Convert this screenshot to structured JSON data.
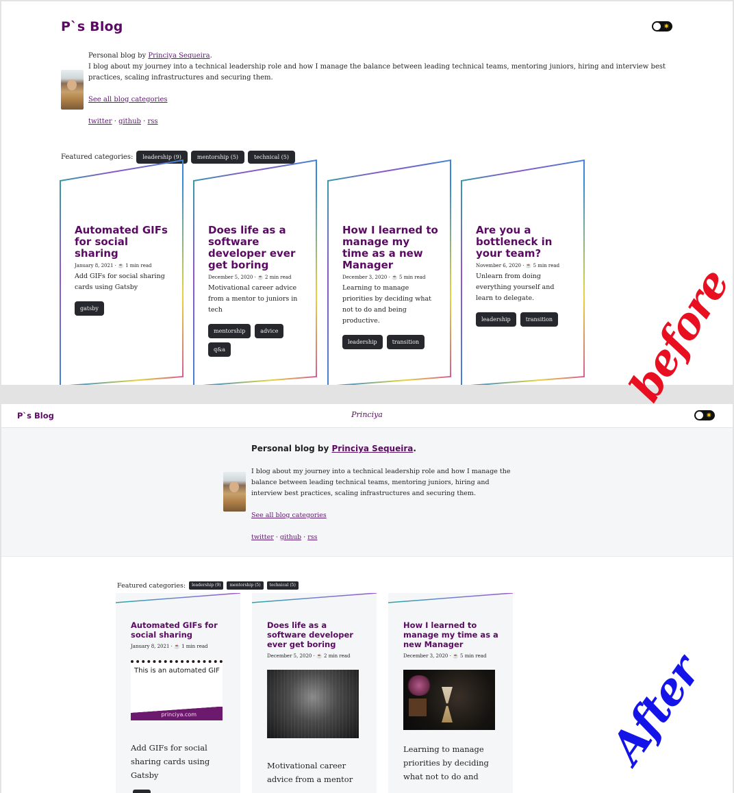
{
  "before": {
    "label": "before",
    "site_title": "P`s Blog",
    "bio": {
      "prefix": "Personal blog by ",
      "author": "Princiya Sequeira",
      "suffix": ".",
      "description": "I blog about my journey into a technical leadership role and how I manage the balance between leading technical teams, mentoring juniors, hiring and interview best practices, scaling infrastructures and securing them.",
      "categories_link": "See all blog categories",
      "social": [
        "twitter",
        "github",
        "rss"
      ],
      "sep": " · "
    },
    "featured_label": "Featured categories:",
    "featured": [
      "leadership (9)",
      "mentorship (5)",
      "technical (5)"
    ],
    "posts": [
      {
        "title": "Automated GIFs for social sharing",
        "date": "January 8, 2021",
        "read": "1 min read",
        "desc": "Add GIFs for social sharing cards using Gatsby",
        "tags": [
          "gatsby"
        ]
      },
      {
        "title": "Does life as a software developer ever get boring",
        "date": "December 5, 2020",
        "read": "2 min read",
        "desc": "Motivational career advice from a mentor to juniors in tech",
        "tags": [
          "mentorship",
          "advice",
          "q&a"
        ]
      },
      {
        "title": "How I learned to manage my time as a new Manager",
        "date": "December 3, 2020",
        "read": "5 min read",
        "desc": "Learning to manage priorities by deciding what not to do and being productive.",
        "tags": [
          "leadership",
          "transition"
        ]
      },
      {
        "title": "Are you a bottleneck in your team?",
        "date": "November 6, 2020",
        "read": "5 min read",
        "desc": "Unlearn from doing everything yourself and learn to delegate.",
        "tags": [
          "leadership",
          "transition"
        ]
      }
    ]
  },
  "after": {
    "label": "After",
    "site_title": "P`s Blog",
    "center_title": "Princiya",
    "bio": {
      "heading_prefix": "Personal blog by ",
      "author": "Princiya Sequeira",
      "heading_suffix": ".",
      "description": "I blog about my journey into a technical leadership role and how I manage the balance between leading technical teams, mentoring juniors, hiring and interview best practices, scaling infrastructures and securing them.",
      "categories_link": "See all blog categories",
      "social": [
        "twitter",
        "github",
        "rss"
      ],
      "sep": " · "
    },
    "featured_label": "Featured categories:",
    "featured": [
      "leadership (9)",
      "mentorship (5)",
      "technical (5)"
    ],
    "gif_text": "This is an automated GIF",
    "gif_url": "princiya.com",
    "posts": [
      {
        "title": "Automated GIFs for social sharing",
        "date": "January 8, 2021",
        "read": "1 min read",
        "desc": "Add GIFs for social sharing cards using Gatsby",
        "image": "gif-card"
      },
      {
        "title": "Does life as a software developer ever get boring",
        "date": "December 5, 2020",
        "read": "2 min read",
        "desc": "Motivational career advice from a mentor",
        "image": "rain-photo"
      },
      {
        "title": "How I learned to manage my time as a new Manager",
        "date": "December 3, 2020",
        "read": "5 min read",
        "desc": "Learning to manage priorities by deciding what not to do and",
        "image": "hourglass-photo"
      }
    ]
  },
  "colors": {
    "brand": "#5a0a62",
    "chip": "#26282e",
    "before_label": "#e81020",
    "after_label": "#1414e8"
  }
}
